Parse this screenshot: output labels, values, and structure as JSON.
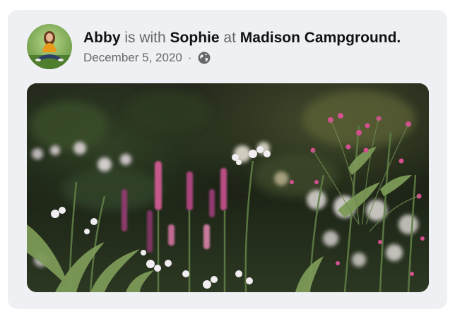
{
  "post": {
    "author": "Abby",
    "with_word": "is with",
    "tagged": "Sophie",
    "at_word": "at",
    "location": "Madison Campground.",
    "date": "December 5, 2020",
    "separator": "·",
    "privacy_icon": "globe-icon",
    "avatar_icon": "user-avatar-photo",
    "photo": "wildflower-meadow-photo"
  },
  "colors": {
    "card_background": "#eff0f4",
    "name_text": "#111214",
    "muted_text": "#65676b"
  }
}
